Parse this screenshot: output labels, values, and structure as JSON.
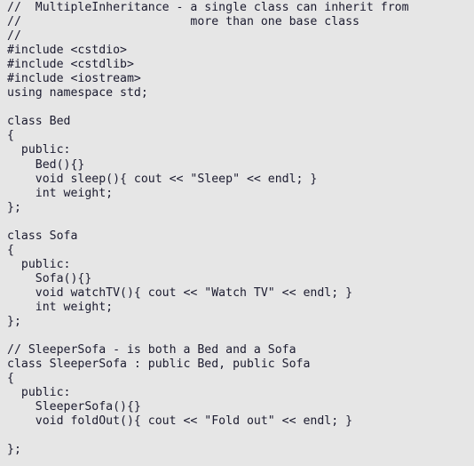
{
  "document": {
    "kind": "source-code-listing",
    "language": "C++",
    "title": "MultipleInheritance",
    "background_color": "#e6e6e6",
    "text_color": "#1b1b2f",
    "font_style": "monospace"
  },
  "code": {
    "lines": [
      "//  MultipleInheritance - a single class can inherit from",
      "//                        more than one base class",
      "//",
      "#include <cstdio>",
      "#include <cstdlib>",
      "#include <iostream>",
      "using namespace std;",
      "",
      "class Bed",
      "{",
      "  public:",
      "    Bed(){}",
      "    void sleep(){ cout << \"Sleep\" << endl; }",
      "    int weight;",
      "};",
      "",
      "class Sofa",
      "{",
      "  public:",
      "    Sofa(){}",
      "    void watchTV(){ cout << \"Watch TV\" << endl; }",
      "    int weight;",
      "};",
      "",
      "// SleeperSofa - is both a Bed and a Sofa",
      "class SleeperSofa : public Bed, public Sofa",
      "{",
      "  public:",
      "    SleeperSofa(){}",
      "    void foldOut(){ cout << \"Fold out\" << endl; }",
      "",
      "};"
    ]
  }
}
